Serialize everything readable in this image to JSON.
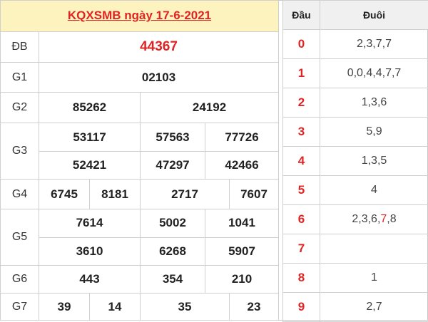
{
  "title": "KQXSMB ngày 17-6-2021",
  "colors": {
    "accent_red": "#e02424",
    "title_bg": "#fdf3bf",
    "header_bg": "#f0f0f0"
  },
  "results": {
    "db": {
      "label": "ĐB",
      "value": "44367"
    },
    "g1": {
      "label": "G1",
      "value": "02103"
    },
    "g2": {
      "label": "G2",
      "values": [
        "85262",
        "24192"
      ]
    },
    "g3": {
      "label": "G3",
      "values": [
        "53117",
        "57563",
        "77726",
        "52421",
        "47297",
        "42466"
      ]
    },
    "g4": {
      "label": "G4",
      "values": [
        "6745",
        "8181",
        "2717",
        "7607"
      ]
    },
    "g5": {
      "label": "G5",
      "values": [
        "7614",
        "5002",
        "1041",
        "3610",
        "6268",
        "5907"
      ]
    },
    "g6": {
      "label": "G6",
      "values": [
        "443",
        "354",
        "210"
      ]
    },
    "g7": {
      "label": "G7",
      "values": [
        "39",
        "14",
        "35",
        "23"
      ]
    }
  },
  "dauduoi": {
    "header_dau": "Đầu",
    "header_duoi": "Đuôi",
    "rows": [
      {
        "dau": "0",
        "duoi": "2,3,7,7"
      },
      {
        "dau": "1",
        "duoi": "0,0,4,4,7,7"
      },
      {
        "dau": "2",
        "duoi": "1,3,6"
      },
      {
        "dau": "3",
        "duoi": "5,9"
      },
      {
        "dau": "4",
        "duoi": "1,3,5"
      },
      {
        "dau": "5",
        "duoi": "4"
      },
      {
        "dau": "6",
        "duoi_pre": "2,3,6,",
        "duoi_hl": "7",
        "duoi_post": ",8"
      },
      {
        "dau": "7",
        "duoi": ""
      },
      {
        "dau": "8",
        "duoi": "1"
      },
      {
        "dau": "9",
        "duoi": "2,7"
      }
    ]
  }
}
